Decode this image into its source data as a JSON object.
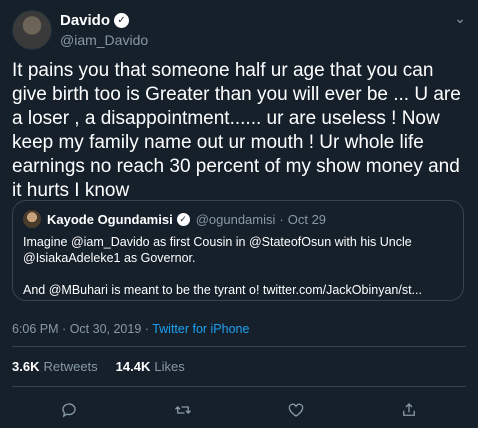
{
  "user": {
    "name": "Davido",
    "handle": "@iam_Davido"
  },
  "tweet": {
    "text": "It pains you that someone half ur age that you can give birth too is Greater than you will ever be ... U are a loser , a disappointment...... ur are useless ! Now keep my family name out ur mouth ! Ur whole life earnings no reach 30 percent of my show money and it hurts I know"
  },
  "quote": {
    "name": "Kayode Ogundamisi",
    "handle": "@ogundamisi",
    "separator": "·",
    "date": "Oct 29",
    "text": "Imagine @iam_Davido as first Cousin in @StateofOsun with his Uncle\n@IsiakaAdeleke1 as Governor.\n\nAnd @MBuhari is meant to be the tyrant o! twitter.com/JackObinyan/st..."
  },
  "meta": {
    "time": "6:06 PM",
    "separator": "·",
    "date": "Oct 30, 2019",
    "source": "Twitter for iPhone"
  },
  "stats": {
    "retweets_count": "3.6K",
    "retweets_label": "Retweets",
    "likes_count": "14.4K",
    "likes_label": "Likes"
  },
  "icons": {
    "menu": "chevron-down-icon",
    "reply": "reply-icon",
    "retweet": "retweet-icon",
    "like": "heart-icon",
    "share": "share-icon"
  },
  "colors": {
    "background": "#15202b",
    "link": "#1da1f2",
    "muted": "#8899a6",
    "border": "#38444d"
  }
}
